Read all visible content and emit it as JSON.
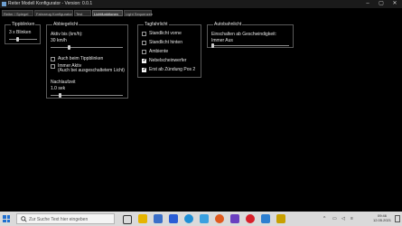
{
  "window": {
    "title": "Reiter Modell Konfigurator - Version: 0.0.1"
  },
  "tabs": [
    {
      "label": "Reiter / Spiegel"
    },
    {
      "label": "Fahrzeug Konfigurator"
    },
    {
      "label": "Test"
    },
    {
      "label": "Lichtfunktionen"
    },
    {
      "label": "Light Sequenzen"
    }
  ],
  "tipp": {
    "title": "Tippblinken",
    "value": "3 x Blinken",
    "slider_fraction": 0.3
  },
  "abbiege": {
    "title": "Abbiegelicht",
    "speed_label": "Aktiv bis (km/h):",
    "speed_value": "30 km/h",
    "speed_fraction": 0.25,
    "auch_tippblinken": {
      "label": "Auch beim Tippblinken",
      "checked": false
    },
    "immer_aktiv": {
      "label_line1": "Immer Aktiv",
      "label_line2": "(Auch bei ausgeschaltetem Licht)",
      "checked": false
    },
    "nachlauf_label": "Nachlaufzeit",
    "nachlauf_value": "1.0 sek",
    "nachlauf_fraction": 0.12
  },
  "tagfahr": {
    "title": "Tagfahrlicht",
    "items": [
      {
        "label": "Standlicht vorne",
        "checked": false
      },
      {
        "label": "Standlicht hinten",
        "checked": false
      },
      {
        "label": "Ambiente",
        "checked": false
      },
      {
        "label": "Nebelscheinwerfer",
        "checked": true
      },
      {
        "label": "Erst ab Zündung Pos 2",
        "checked": true
      }
    ]
  },
  "autobahn": {
    "title": "Autobahnlicht",
    "label": "Einschalten ab Geschwindigkeit:",
    "value": "Immer Aus",
    "slider_fraction": 0.0
  },
  "taskbar": {
    "search_placeholder": "Zur Suche Text hier eingeben",
    "time": "09:46",
    "date": "12.05.2021"
  },
  "colors": {
    "background": "#000000",
    "taskbar": "#dadada",
    "accent": "#1f6fd0"
  }
}
